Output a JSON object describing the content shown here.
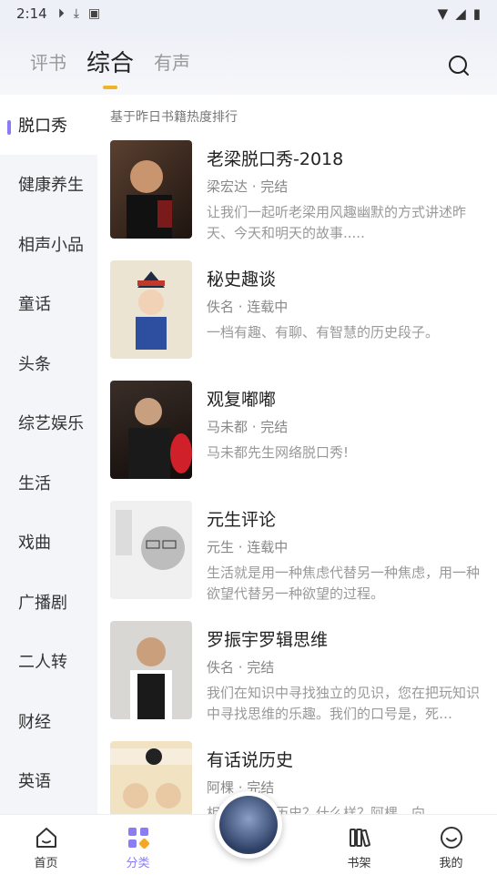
{
  "status_bar": {
    "time": "2:14"
  },
  "header": {
    "tabs": [
      {
        "label": "评书",
        "active": false
      },
      {
        "label": "综合",
        "active": true
      },
      {
        "label": "有声",
        "active": false
      }
    ],
    "search_icon": "search-icon",
    "accent_color": "#f0b429"
  },
  "sidebar": {
    "items": [
      {
        "label": "脱口秀",
        "active": true
      },
      {
        "label": "健康养生"
      },
      {
        "label": "相声小品"
      },
      {
        "label": "童话"
      },
      {
        "label": "头条"
      },
      {
        "label": "综艺娱乐"
      },
      {
        "label": "生活"
      },
      {
        "label": "戏曲"
      },
      {
        "label": "广播剧"
      },
      {
        "label": "二人转"
      },
      {
        "label": "财经"
      },
      {
        "label": "英语"
      }
    ],
    "indicator_color": "#8b7cf6"
  },
  "main": {
    "caption": "基于昨日书籍热度排行",
    "books": [
      {
        "title": "老梁脱口秀-2018",
        "meta": "梁宏达 · 完结",
        "desc": "让我们一起听老梁用风趣幽默的方式讲述昨天、今天和明天的故事.....",
        "cover_color": "#3a2a22"
      },
      {
        "title": "秘史趣谈",
        "meta": "佚名 · 连载中",
        "desc": "一档有趣、有聊、有智慧的历史段子。",
        "cover_color": "#e9e2d0"
      },
      {
        "title": "观复嘟嘟",
        "meta": "马未都 · 完结",
        "desc": "马未都先生网络脱口秀!",
        "cover_color": "#2a2220"
      },
      {
        "title": "元生评论",
        "meta": "元生 · 连载中",
        "desc": "生活就是用一种焦虑代替另一种焦虑，用一种欲望代替另一种欲望的过程。",
        "cover_color": "#f2f2f2"
      },
      {
        "title": "罗振宇罗辑思维",
        "meta": "佚名 · 完结",
        "desc": "我们在知识中寻找独立的见识，您在把玩知识中寻找思维的乐趣。我们的口号是，死…",
        "cover_color": "#d8d6d3"
      },
      {
        "title": "有话说历史",
        "meta": "阿棵 · 完结",
        "desc": "相貌好像？历史？什么样？阿棵、向",
        "cover_color": "#f3e6c8"
      }
    ]
  },
  "bottom_nav": {
    "items": [
      {
        "label": "首页",
        "icon": "home-icon",
        "active": false
      },
      {
        "label": "分类",
        "icon": "category-icon",
        "active": true
      },
      {
        "label": "书架",
        "icon": "bookshelf-icon",
        "active": false
      },
      {
        "label": "我的",
        "icon": "profile-icon",
        "active": false
      }
    ],
    "active_color": "#8b7cf6"
  }
}
